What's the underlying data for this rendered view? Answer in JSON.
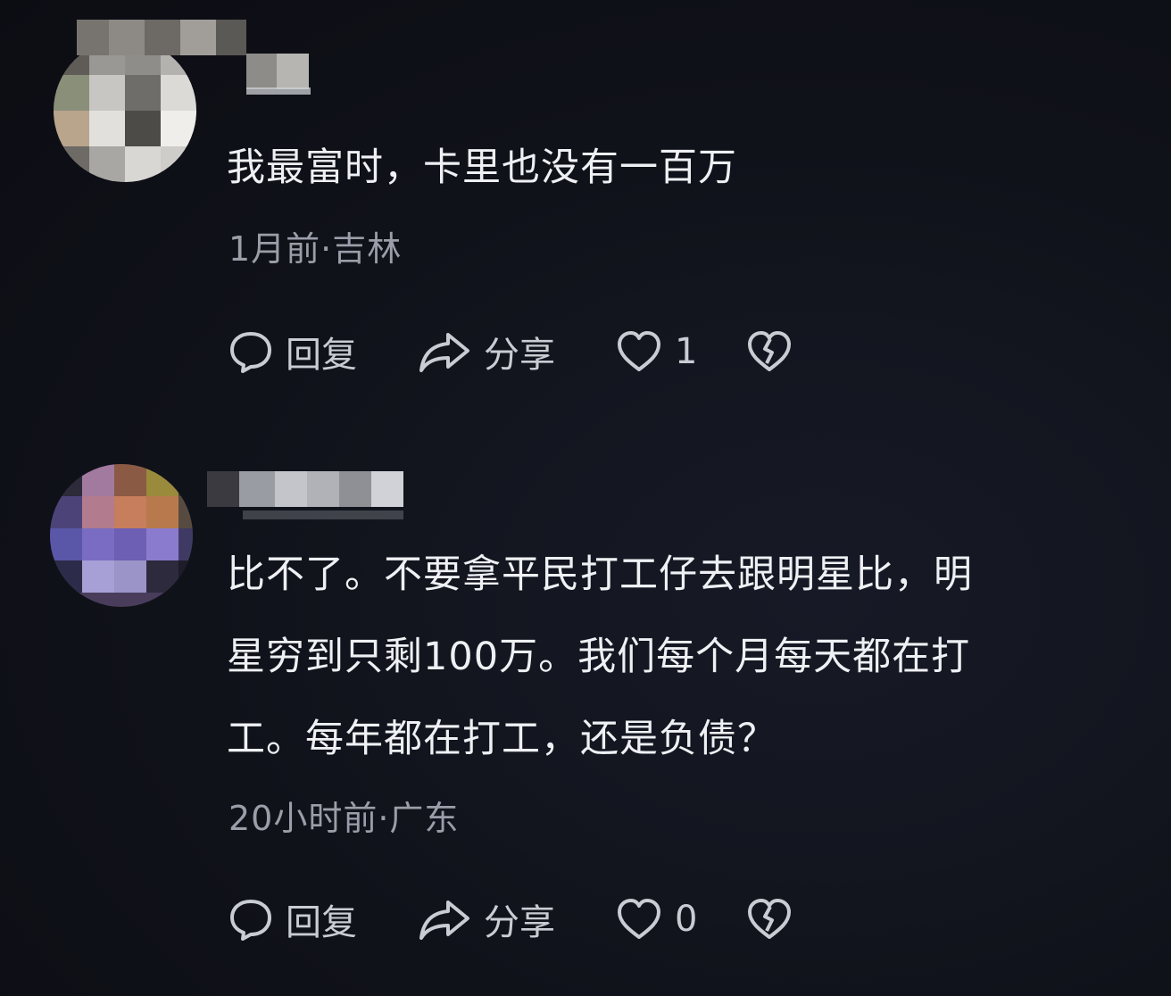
{
  "comments": [
    {
      "content": "我最富时，卡里也没有一百万",
      "meta": "1月前·吉林",
      "actions": {
        "reply_label": "回复",
        "share_label": "分享",
        "like_count": "1"
      },
      "icons": [
        "reply-icon",
        "share-icon",
        "heart-icon",
        "broken-heart-icon"
      ]
    },
    {
      "content": "比不了。不要拿平民打工仔去跟明星比，明\n星穷到只剩100万。我们每个月每天都在打\n工。每年都在打工，还是负债？",
      "meta": "20小时前·广东",
      "actions": {
        "reply_label": "回复",
        "share_label": "分享",
        "like_count": "0"
      },
      "icons": [
        "reply-icon",
        "share-icon",
        "heart-icon",
        "broken-heart-icon"
      ]
    }
  ],
  "colors": {
    "background": "#10121a",
    "text_primary": "#eef0f3",
    "text_meta": "#9a9ea8",
    "icon": "#c9ccd2"
  }
}
